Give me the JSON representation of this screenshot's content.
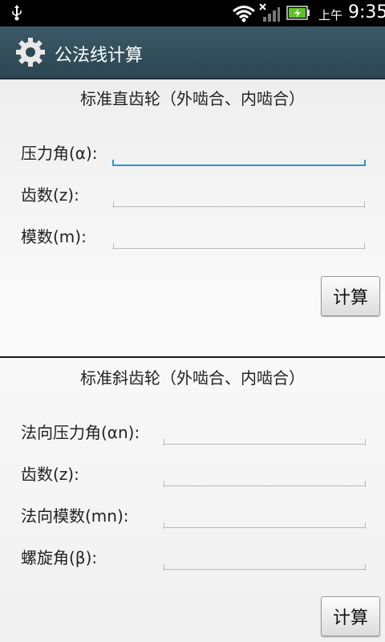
{
  "status_bar": {
    "ampm": "上午",
    "time": "9:35"
  },
  "app": {
    "title": "公法线计算"
  },
  "spur": {
    "title": "标准直齿轮（外啮合、内啮合）",
    "pressure_label": "压力角(α):",
    "teeth_label": "齿数(z):",
    "module_label": "模数(m):",
    "calc_label": "计算"
  },
  "helical": {
    "title": "标准斜齿轮（外啮合、内啮合）",
    "normal_pressure_label": "法向压力角(αn):",
    "teeth_label": "齿数(z):",
    "normal_module_label": "法向模数(mn):",
    "helix_label": "螺旋角(β):",
    "calc_label": "计算"
  },
  "colors": {
    "titlebar": "#2c4652",
    "focus": "#2b95c9"
  }
}
